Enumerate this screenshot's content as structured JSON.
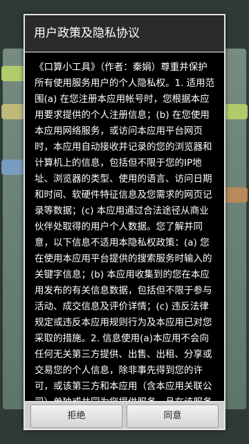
{
  "dialog": {
    "title": "用户政策及隐私协议",
    "body": "《口算小工具》（作者：秦娟）尊重并保护所有使用服务用户的个人隐私权。1. 适用范围(a) 在您注册本应用帐号时，您根据本应用要求提供的个人注册信息；(b) 在您使用本应用网络服务，或访问本应用平台网页时，本应用自动接收并记录的您的浏览器和计算机上的信息，包括但不限于您的IP地址、浏览器的类型、使用的语言、访问日期和时间、软硬件特征信息及您需求的网页记录等数据；(c) 本应用通过合法途径从商业伙伴处取得的用户个人数据。您了解并同意，以下信息不适用本隐私权政策：(a) 您在使用本应用平台提供的搜索服务时输入的关键字信息；(b) 本应用收集到的您在本应用发布的有关信息数据，包括但不限于参与活动、成交信息及评价详情；(c) 违反法律规定或违反本应用规则行为及本应用已对您采取的措施。2. 信息使用(a)本应用不会向任何无关第三方提供、出售、出租、分享或交易您的个人信息，除非事先得到您的许可，或该第三方和本应用（含本应用关联公司）单独或共同为您提供服务，且在该服务结束后，其将被禁止访问包括其以前能够访",
    "decline_label": "拒绝",
    "agree_label": "同意"
  }
}
